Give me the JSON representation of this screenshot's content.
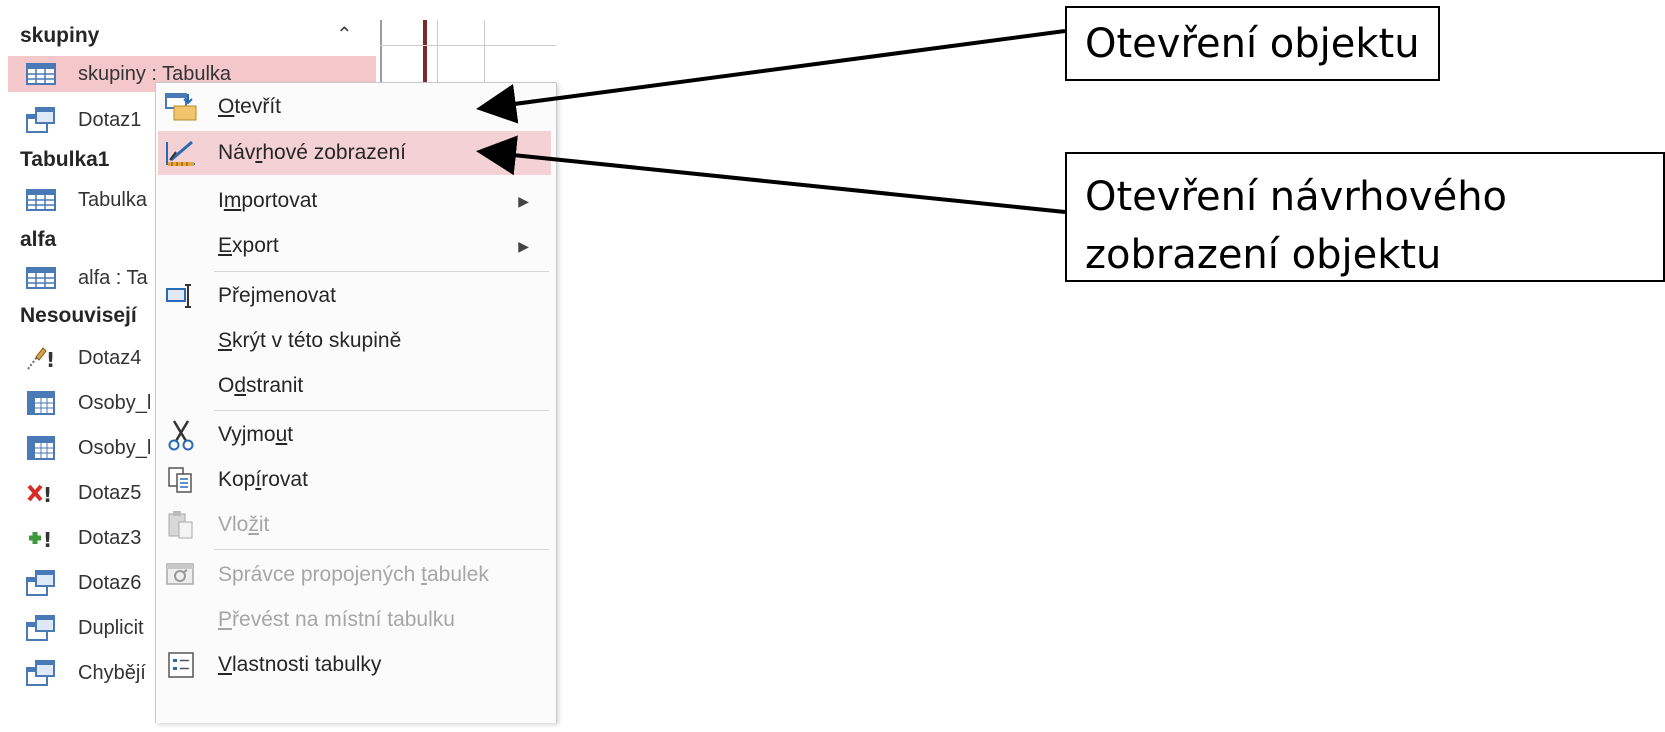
{
  "nav": {
    "groups": [
      {
        "label": "skupiny"
      },
      {
        "label": "Tabulka1"
      },
      {
        "label": "alfa"
      },
      {
        "label": "Nesouvisejí"
      }
    ],
    "items": [
      {
        "label": "skupiny : Tabulka",
        "icon": "table-icon"
      },
      {
        "label": "Dotaz1",
        "icon": "query-icon"
      },
      {
        "label": "Tabulka",
        "icon": "table-icon"
      },
      {
        "label": "alfa : Ta",
        "icon": "table-icon"
      },
      {
        "label": "Dotaz4",
        "icon": "update-query-icon"
      },
      {
        "label": "Osoby_l",
        "icon": "crosstab-icon"
      },
      {
        "label": "Osoby_l",
        "icon": "crosstab-icon"
      },
      {
        "label": "Dotaz5",
        "icon": "delete-query-icon"
      },
      {
        "label": "Dotaz3",
        "icon": "append-query-icon"
      },
      {
        "label": "Dotaz6",
        "icon": "query-icon"
      },
      {
        "label": "Duplicit",
        "icon": "query-icon"
      },
      {
        "label": "Chybějí",
        "icon": "query-icon"
      }
    ],
    "collapse_icon": "double-chevron-up-icon"
  },
  "menu": {
    "items": [
      {
        "pre": "",
        "acc": "O",
        "post": "tevřít",
        "icon": "open-icon"
      },
      {
        "pre": "Náv",
        "acc": "r",
        "post": "hové zobrazení",
        "icon": "design-view-icon"
      },
      {
        "pre": "I",
        "acc": "m",
        "post": "portovat",
        "icon": ""
      },
      {
        "pre": "",
        "acc": "E",
        "post": "xport",
        "icon": ""
      },
      {
        "pre": "Pře",
        "acc": "j",
        "post": "menovat",
        "icon": "rename-icon"
      },
      {
        "pre": "",
        "acc": "S",
        "post": "krýt v této skupině",
        "icon": ""
      },
      {
        "pre": "O",
        "acc": "d",
        "post": "stranit",
        "icon": ""
      },
      {
        "pre": "Vyjmo",
        "acc": "u",
        "post": "t",
        "icon": "scissors-icon"
      },
      {
        "pre": "Kop",
        "acc": "í",
        "post": "rovat",
        "icon": "copy-icon"
      },
      {
        "pre": "Vlo",
        "acc": "ž",
        "post": "it",
        "icon": "paste-icon"
      },
      {
        "pre": "Správce propojených ",
        "acc": "t",
        "post": "abulek",
        "icon": "linked-table-manager-icon"
      },
      {
        "pre": "",
        "acc": "P",
        "post": "řevést na místní tabulku",
        "icon": ""
      },
      {
        "pre": "",
        "acc": "V",
        "post": "lastnosti tabulky",
        "icon": "properties-icon"
      }
    ]
  },
  "callouts": {
    "open": "Otevření objektu",
    "design_line1": "Otevření návrhového",
    "design_line2": "zobrazení objektu"
  },
  "colors": {
    "selection": "#f4c7cb",
    "highlight": "#f4d1d4",
    "disabled_text": "#a6a6a6"
  }
}
